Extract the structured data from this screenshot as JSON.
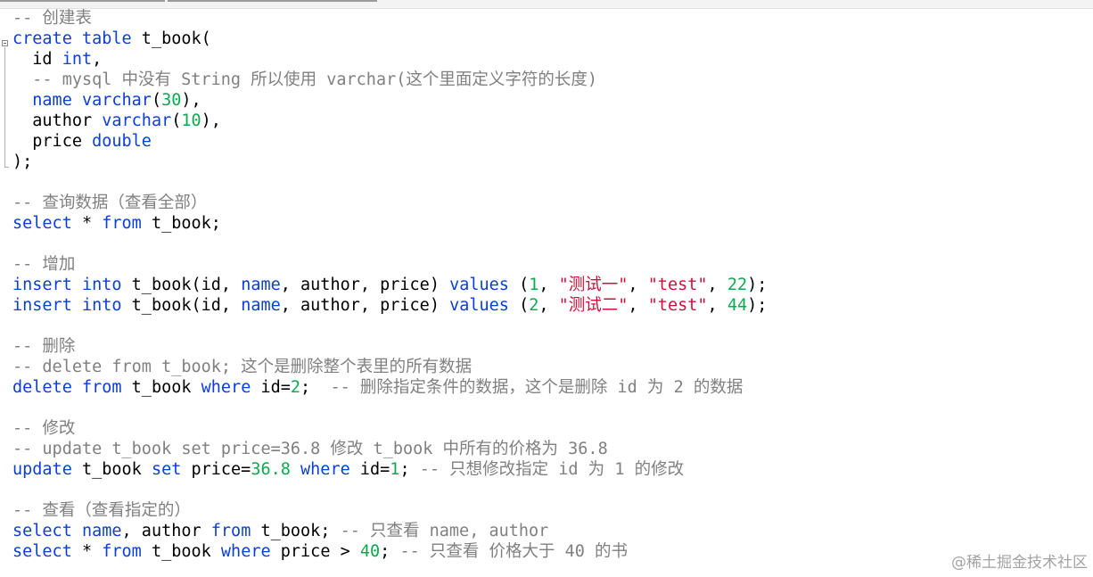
{
  "editor": {
    "lines": [
      [
        {
          "c": "cmt",
          "t": "-- 创建表"
        }
      ],
      [
        {
          "c": "kw",
          "t": "create"
        },
        {
          "c": "plain",
          "t": " "
        },
        {
          "c": "kw",
          "t": "table"
        },
        {
          "c": "plain",
          "t": " t_book("
        }
      ],
      [
        {
          "c": "plain",
          "t": "  id "
        },
        {
          "c": "kw",
          "t": "int"
        },
        {
          "c": "plain",
          "t": ","
        }
      ],
      [
        {
          "c": "cmt",
          "t": "  -- mysql 中没有 String 所以使用 varchar(这个里面定义字符的长度)"
        }
      ],
      [
        {
          "c": "plain",
          "t": "  "
        },
        {
          "c": "kw",
          "t": "name"
        },
        {
          "c": "plain",
          "t": " "
        },
        {
          "c": "kw",
          "t": "varchar"
        },
        {
          "c": "plain",
          "t": "("
        },
        {
          "c": "num",
          "t": "30"
        },
        {
          "c": "plain",
          "t": "),"
        }
      ],
      [
        {
          "c": "plain",
          "t": "  author "
        },
        {
          "c": "kw",
          "t": "varchar"
        },
        {
          "c": "plain",
          "t": "("
        },
        {
          "c": "num",
          "t": "10"
        },
        {
          "c": "plain",
          "t": "),"
        }
      ],
      [
        {
          "c": "plain",
          "t": "  price "
        },
        {
          "c": "kw",
          "t": "double"
        }
      ],
      [
        {
          "c": "plain",
          "t": ");"
        }
      ],
      [],
      [
        {
          "c": "cmt",
          "t": "-- 查询数据（查看全部）"
        }
      ],
      [
        {
          "c": "kw",
          "t": "select"
        },
        {
          "c": "plain",
          "t": " * "
        },
        {
          "c": "kw",
          "t": "from"
        },
        {
          "c": "plain",
          "t": " t_book;"
        }
      ],
      [],
      [
        {
          "c": "cmt",
          "t": "-- 增加"
        }
      ],
      [
        {
          "c": "kw",
          "t": "insert"
        },
        {
          "c": "plain",
          "t": " "
        },
        {
          "c": "kw",
          "t": "into"
        },
        {
          "c": "plain",
          "t": " t_book(id, "
        },
        {
          "c": "kw",
          "t": "name"
        },
        {
          "c": "plain",
          "t": ", author, price) "
        },
        {
          "c": "kw",
          "t": "values"
        },
        {
          "c": "plain",
          "t": " ("
        },
        {
          "c": "num",
          "t": "1"
        },
        {
          "c": "plain",
          "t": ", "
        },
        {
          "c": "str",
          "t": "\"测试一\""
        },
        {
          "c": "plain",
          "t": ", "
        },
        {
          "c": "str",
          "t": "\"test\""
        },
        {
          "c": "plain",
          "t": ", "
        },
        {
          "c": "num",
          "t": "22"
        },
        {
          "c": "plain",
          "t": ");"
        }
      ],
      [
        {
          "c": "kw",
          "t": "insert"
        },
        {
          "c": "plain",
          "t": " "
        },
        {
          "c": "kw",
          "t": "into"
        },
        {
          "c": "plain",
          "t": " t_book(id, "
        },
        {
          "c": "kw",
          "t": "name"
        },
        {
          "c": "plain",
          "t": ", author, price) "
        },
        {
          "c": "kw",
          "t": "values"
        },
        {
          "c": "plain",
          "t": " ("
        },
        {
          "c": "num",
          "t": "2"
        },
        {
          "c": "plain",
          "t": ", "
        },
        {
          "c": "str",
          "t": "\"测试二\""
        },
        {
          "c": "plain",
          "t": ", "
        },
        {
          "c": "str",
          "t": "\"test\""
        },
        {
          "c": "plain",
          "t": ", "
        },
        {
          "c": "num",
          "t": "44"
        },
        {
          "c": "plain",
          "t": ");"
        }
      ],
      [],
      [
        {
          "c": "cmt",
          "t": "-- 删除"
        }
      ],
      [
        {
          "c": "cmt",
          "t": "-- delete from t_book; 这个是删除整个表里的所有数据"
        }
      ],
      [
        {
          "c": "kw",
          "t": "delete"
        },
        {
          "c": "plain",
          "t": " "
        },
        {
          "c": "kw",
          "t": "from"
        },
        {
          "c": "plain",
          "t": " t_book "
        },
        {
          "c": "kw",
          "t": "where"
        },
        {
          "c": "plain",
          "t": " id="
        },
        {
          "c": "num",
          "t": "2"
        },
        {
          "c": "plain",
          "t": ";  "
        },
        {
          "c": "cmt",
          "t": "-- 删除指定条件的数据，这个是删除 id 为 2 的数据"
        }
      ],
      [],
      [
        {
          "c": "cmt",
          "t": "-- 修改"
        }
      ],
      [
        {
          "c": "cmt",
          "t": "-- update t_book set price=36.8 修改 t_book 中所有的价格为 36.8"
        }
      ],
      [
        {
          "c": "kw",
          "t": "update"
        },
        {
          "c": "plain",
          "t": " t_book "
        },
        {
          "c": "kw",
          "t": "set"
        },
        {
          "c": "plain",
          "t": " price="
        },
        {
          "c": "num",
          "t": "36.8"
        },
        {
          "c": "plain",
          "t": " "
        },
        {
          "c": "kw",
          "t": "where"
        },
        {
          "c": "plain",
          "t": " id="
        },
        {
          "c": "num",
          "t": "1"
        },
        {
          "c": "plain",
          "t": "; "
        },
        {
          "c": "cmt",
          "t": "-- 只想修改指定 id 为 1 的修改"
        }
      ],
      [],
      [
        {
          "c": "cmt",
          "t": "-- 查看（查看指定的）"
        }
      ],
      [
        {
          "c": "kw",
          "t": "select"
        },
        {
          "c": "plain",
          "t": " "
        },
        {
          "c": "kw",
          "t": "name"
        },
        {
          "c": "plain",
          "t": ", author "
        },
        {
          "c": "kw",
          "t": "from"
        },
        {
          "c": "plain",
          "t": " t_book; "
        },
        {
          "c": "cmt",
          "t": "-- 只查看 name, author"
        }
      ],
      [
        {
          "c": "kw",
          "t": "select"
        },
        {
          "c": "plain",
          "t": " * "
        },
        {
          "c": "kw",
          "t": "from"
        },
        {
          "c": "plain",
          "t": " t_book "
        },
        {
          "c": "kw",
          "t": "where"
        },
        {
          "c": "plain",
          "t": " price > "
        },
        {
          "c": "num",
          "t": "40"
        },
        {
          "c": "plain",
          "t": "; "
        },
        {
          "c": "cmt",
          "t": "-- 只查看 价格大于 40 的书"
        }
      ]
    ]
  },
  "watermark": {
    "text": "@稀土掘金技术社区"
  },
  "colors": {
    "keyword": "#0b3fd6",
    "number": "#0ea94f",
    "string": "#d0103a",
    "comment": "#808080",
    "text": "#000000"
  }
}
